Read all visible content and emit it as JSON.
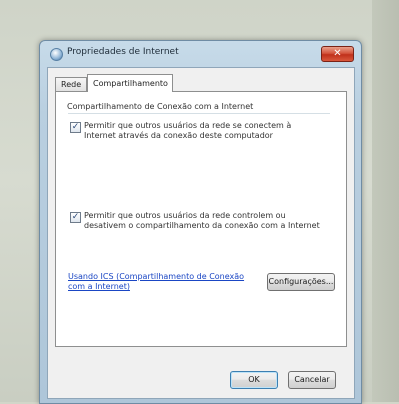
{
  "window": {
    "title": "Propriedades de Internet",
    "close_glyph": "✕"
  },
  "tabs": [
    {
      "label": "Rede",
      "active": false
    },
    {
      "label": "Compartilhamento",
      "active": true
    }
  ],
  "group": {
    "title": "Compartilhamento de Conexão com a Internet"
  },
  "options": [
    {
      "checked": true,
      "label": "Permitir que outros usuários da rede se conectem à Internet através da conexão deste computador"
    },
    {
      "checked": true,
      "label": "Permitir que outros usuários da rede controlem ou desativem o compartilhamento da conexão com a Internet"
    }
  ],
  "link": {
    "text": "Usando ICS (Compartilhamento de Conexão com a Internet)"
  },
  "buttons": {
    "config": "Configurações...",
    "ok": "OK",
    "cancel": "Cancelar"
  },
  "icons": {
    "title": "internet-options-icon",
    "check": "checkmark-icon"
  }
}
